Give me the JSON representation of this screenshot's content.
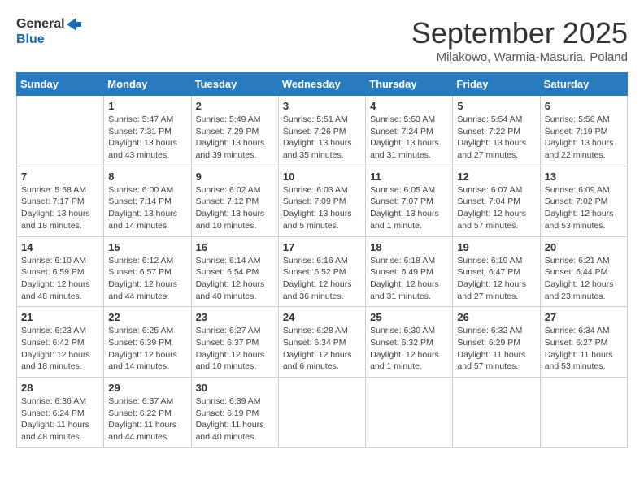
{
  "logo": {
    "line1": "General",
    "line2": "Blue"
  },
  "title": "September 2025",
  "subtitle": "Milakowo, Warmia-Masuria, Poland",
  "days_of_week": [
    "Sunday",
    "Monday",
    "Tuesday",
    "Wednesday",
    "Thursday",
    "Friday",
    "Saturday"
  ],
  "weeks": [
    [
      {
        "day": "",
        "info": ""
      },
      {
        "day": "1",
        "info": "Sunrise: 5:47 AM\nSunset: 7:31 PM\nDaylight: 13 hours\nand 43 minutes."
      },
      {
        "day": "2",
        "info": "Sunrise: 5:49 AM\nSunset: 7:29 PM\nDaylight: 13 hours\nand 39 minutes."
      },
      {
        "day": "3",
        "info": "Sunrise: 5:51 AM\nSunset: 7:26 PM\nDaylight: 13 hours\nand 35 minutes."
      },
      {
        "day": "4",
        "info": "Sunrise: 5:53 AM\nSunset: 7:24 PM\nDaylight: 13 hours\nand 31 minutes."
      },
      {
        "day": "5",
        "info": "Sunrise: 5:54 AM\nSunset: 7:22 PM\nDaylight: 13 hours\nand 27 minutes."
      },
      {
        "day": "6",
        "info": "Sunrise: 5:56 AM\nSunset: 7:19 PM\nDaylight: 13 hours\nand 22 minutes."
      }
    ],
    [
      {
        "day": "7",
        "info": "Sunrise: 5:58 AM\nSunset: 7:17 PM\nDaylight: 13 hours\nand 18 minutes."
      },
      {
        "day": "8",
        "info": "Sunrise: 6:00 AM\nSunset: 7:14 PM\nDaylight: 13 hours\nand 14 minutes."
      },
      {
        "day": "9",
        "info": "Sunrise: 6:02 AM\nSunset: 7:12 PM\nDaylight: 13 hours\nand 10 minutes."
      },
      {
        "day": "10",
        "info": "Sunrise: 6:03 AM\nSunset: 7:09 PM\nDaylight: 13 hours\nand 5 minutes."
      },
      {
        "day": "11",
        "info": "Sunrise: 6:05 AM\nSunset: 7:07 PM\nDaylight: 13 hours\nand 1 minute."
      },
      {
        "day": "12",
        "info": "Sunrise: 6:07 AM\nSunset: 7:04 PM\nDaylight: 12 hours\nand 57 minutes."
      },
      {
        "day": "13",
        "info": "Sunrise: 6:09 AM\nSunset: 7:02 PM\nDaylight: 12 hours\nand 53 minutes."
      }
    ],
    [
      {
        "day": "14",
        "info": "Sunrise: 6:10 AM\nSunset: 6:59 PM\nDaylight: 12 hours\nand 48 minutes."
      },
      {
        "day": "15",
        "info": "Sunrise: 6:12 AM\nSunset: 6:57 PM\nDaylight: 12 hours\nand 44 minutes."
      },
      {
        "day": "16",
        "info": "Sunrise: 6:14 AM\nSunset: 6:54 PM\nDaylight: 12 hours\nand 40 minutes."
      },
      {
        "day": "17",
        "info": "Sunrise: 6:16 AM\nSunset: 6:52 PM\nDaylight: 12 hours\nand 36 minutes."
      },
      {
        "day": "18",
        "info": "Sunrise: 6:18 AM\nSunset: 6:49 PM\nDaylight: 12 hours\nand 31 minutes."
      },
      {
        "day": "19",
        "info": "Sunrise: 6:19 AM\nSunset: 6:47 PM\nDaylight: 12 hours\nand 27 minutes."
      },
      {
        "day": "20",
        "info": "Sunrise: 6:21 AM\nSunset: 6:44 PM\nDaylight: 12 hours\nand 23 minutes."
      }
    ],
    [
      {
        "day": "21",
        "info": "Sunrise: 6:23 AM\nSunset: 6:42 PM\nDaylight: 12 hours\nand 18 minutes."
      },
      {
        "day": "22",
        "info": "Sunrise: 6:25 AM\nSunset: 6:39 PM\nDaylight: 12 hours\nand 14 minutes."
      },
      {
        "day": "23",
        "info": "Sunrise: 6:27 AM\nSunset: 6:37 PM\nDaylight: 12 hours\nand 10 minutes."
      },
      {
        "day": "24",
        "info": "Sunrise: 6:28 AM\nSunset: 6:34 PM\nDaylight: 12 hours\nand 6 minutes."
      },
      {
        "day": "25",
        "info": "Sunrise: 6:30 AM\nSunset: 6:32 PM\nDaylight: 12 hours\nand 1 minute."
      },
      {
        "day": "26",
        "info": "Sunrise: 6:32 AM\nSunset: 6:29 PM\nDaylight: 11 hours\nand 57 minutes."
      },
      {
        "day": "27",
        "info": "Sunrise: 6:34 AM\nSunset: 6:27 PM\nDaylight: 11 hours\nand 53 minutes."
      }
    ],
    [
      {
        "day": "28",
        "info": "Sunrise: 6:36 AM\nSunset: 6:24 PM\nDaylight: 11 hours\nand 48 minutes."
      },
      {
        "day": "29",
        "info": "Sunrise: 6:37 AM\nSunset: 6:22 PM\nDaylight: 11 hours\nand 44 minutes."
      },
      {
        "day": "30",
        "info": "Sunrise: 6:39 AM\nSunset: 6:19 PM\nDaylight: 11 hours\nand 40 minutes."
      },
      {
        "day": "",
        "info": ""
      },
      {
        "day": "",
        "info": ""
      },
      {
        "day": "",
        "info": ""
      },
      {
        "day": "",
        "info": ""
      }
    ]
  ]
}
